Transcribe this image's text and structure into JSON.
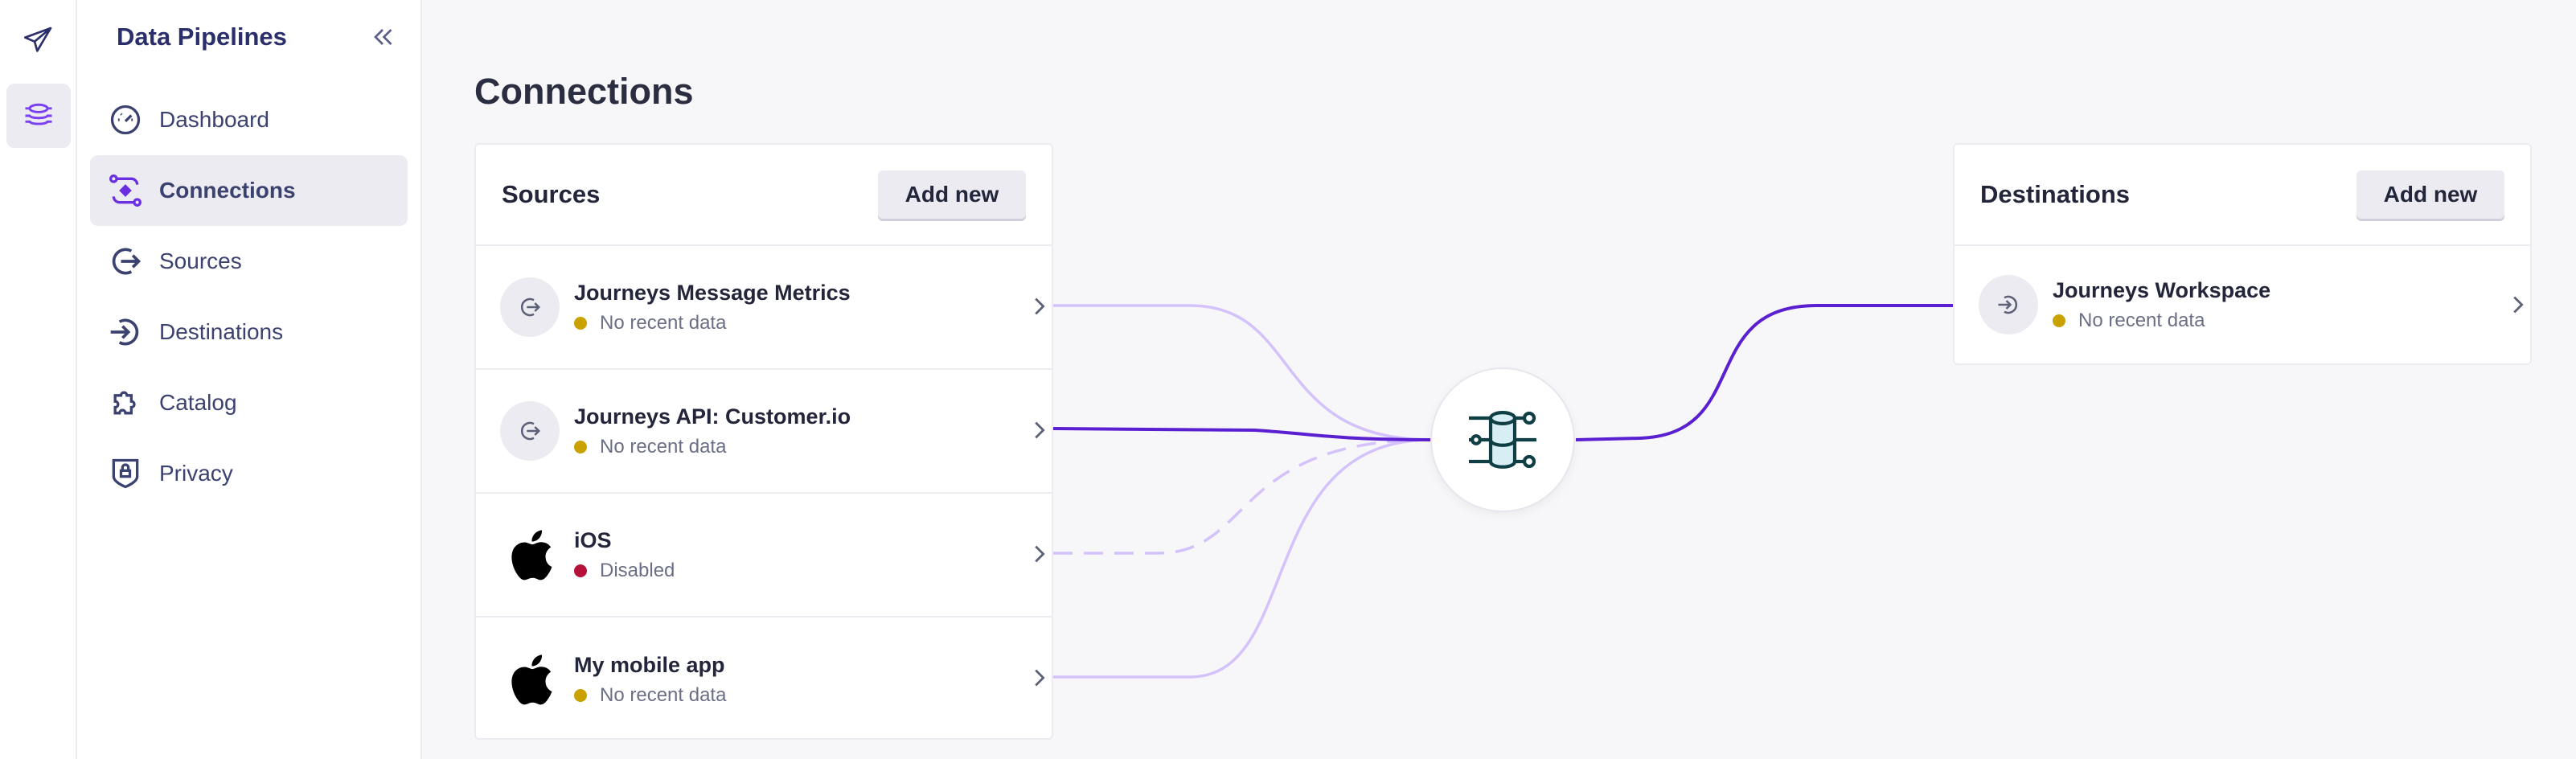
{
  "sidebar": {
    "title": "Data Pipelines",
    "items": [
      {
        "label": "Dashboard",
        "icon": "gauge-icon"
      },
      {
        "label": "Connections",
        "icon": "connections-icon",
        "active": true
      },
      {
        "label": "Sources",
        "icon": "source-arrow-icon"
      },
      {
        "label": "Destinations",
        "icon": "destination-arrow-icon"
      },
      {
        "label": "Catalog",
        "icon": "puzzle-icon"
      },
      {
        "label": "Privacy",
        "icon": "shield-lock-icon"
      }
    ]
  },
  "page": {
    "title": "Connections"
  },
  "sources": {
    "title": "Sources",
    "add_label": "Add new",
    "items": [
      {
        "name": "Journeys Message Metrics",
        "status": "No recent data",
        "status_color": "#c9a100",
        "icon": "source-icon",
        "connected": true
      },
      {
        "name": "Journeys API: Customer.io",
        "status": "No recent data",
        "status_color": "#c9a100",
        "icon": "source-icon",
        "connected": true,
        "highlighted": true
      },
      {
        "name": "iOS",
        "status": "Disabled",
        "status_color": "#b5123a",
        "icon": "apple-icon",
        "connected": false
      },
      {
        "name": "My mobile app",
        "status": "No recent data",
        "status_color": "#c9a100",
        "icon": "apple-icon",
        "connected": true
      }
    ]
  },
  "destinations": {
    "title": "Destinations",
    "add_label": "Add new",
    "items": [
      {
        "name": "Journeys Workspace",
        "status": "No recent data",
        "status_color": "#c9a100",
        "icon": "destination-icon"
      }
    ]
  },
  "colors": {
    "accent": "#5a1fd1",
    "link_light": "#d4c2fb",
    "rail_active": "#7b3ff2"
  }
}
